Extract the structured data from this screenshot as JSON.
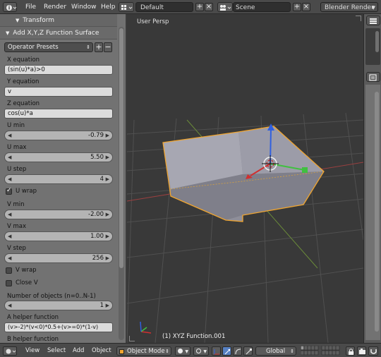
{
  "topbar": {
    "menus": [
      "File",
      "Render",
      "Window",
      "Help"
    ],
    "screen_layout": "Default",
    "scene": "Scene",
    "render_engine": "Blender Render",
    "add_symbol": "+",
    "close_symbol": "×"
  },
  "left_panel": {
    "transform_header": "Transform",
    "operator_header": "Add X,Y,Z Function Surface",
    "operator_presets": "Operator Presets",
    "fields": {
      "x_eq_label": "X equation",
      "x_eq_value": "(sin(u)*a)>0",
      "y_eq_label": "Y equation",
      "y_eq_value": "v",
      "z_eq_label": "Z equation",
      "z_eq_value": "cos(u)*a",
      "umin_label": "U min",
      "umin_value": "-0.79",
      "umax_label": "U max",
      "umax_value": "5.50",
      "ustep_label": "U step",
      "ustep_value": "4",
      "uwrap_label": "U wrap",
      "uwrap_checked": true,
      "vmin_label": "V min",
      "vmin_value": "-2.00",
      "vmax_label": "V max",
      "vmax_value": "1.00",
      "vstep_label": "V step",
      "vstep_value": "256",
      "vwrap_label": "V wrap",
      "vwrap_checked": false,
      "closev_label": "Close V",
      "closev_checked": false,
      "nobj_label": "Number of objects (n=0..N-1)",
      "nobj_value": "1",
      "helperA_label": "A helper function",
      "helperA_value": "(v>-2)*(v<0)*0.5+(v>=0)*(1-v)",
      "helperB_label": "B helper function"
    }
  },
  "viewport": {
    "view_name": "User Persp",
    "object_name": "(1) XYZ Function.001"
  },
  "bottombar": {
    "view": "View",
    "select": "Select",
    "add": "Add",
    "object": "Object",
    "mode": "Object Mode",
    "orientation": "Global"
  },
  "colors": {
    "header_bg": "#4a4a4a",
    "panel_bg": "#727272",
    "viewport_bg": "#393939",
    "selection_outline": "#f0a530",
    "axis_x": "#d03030",
    "axis_y": "#40c040",
    "axis_z": "#3060e0"
  }
}
